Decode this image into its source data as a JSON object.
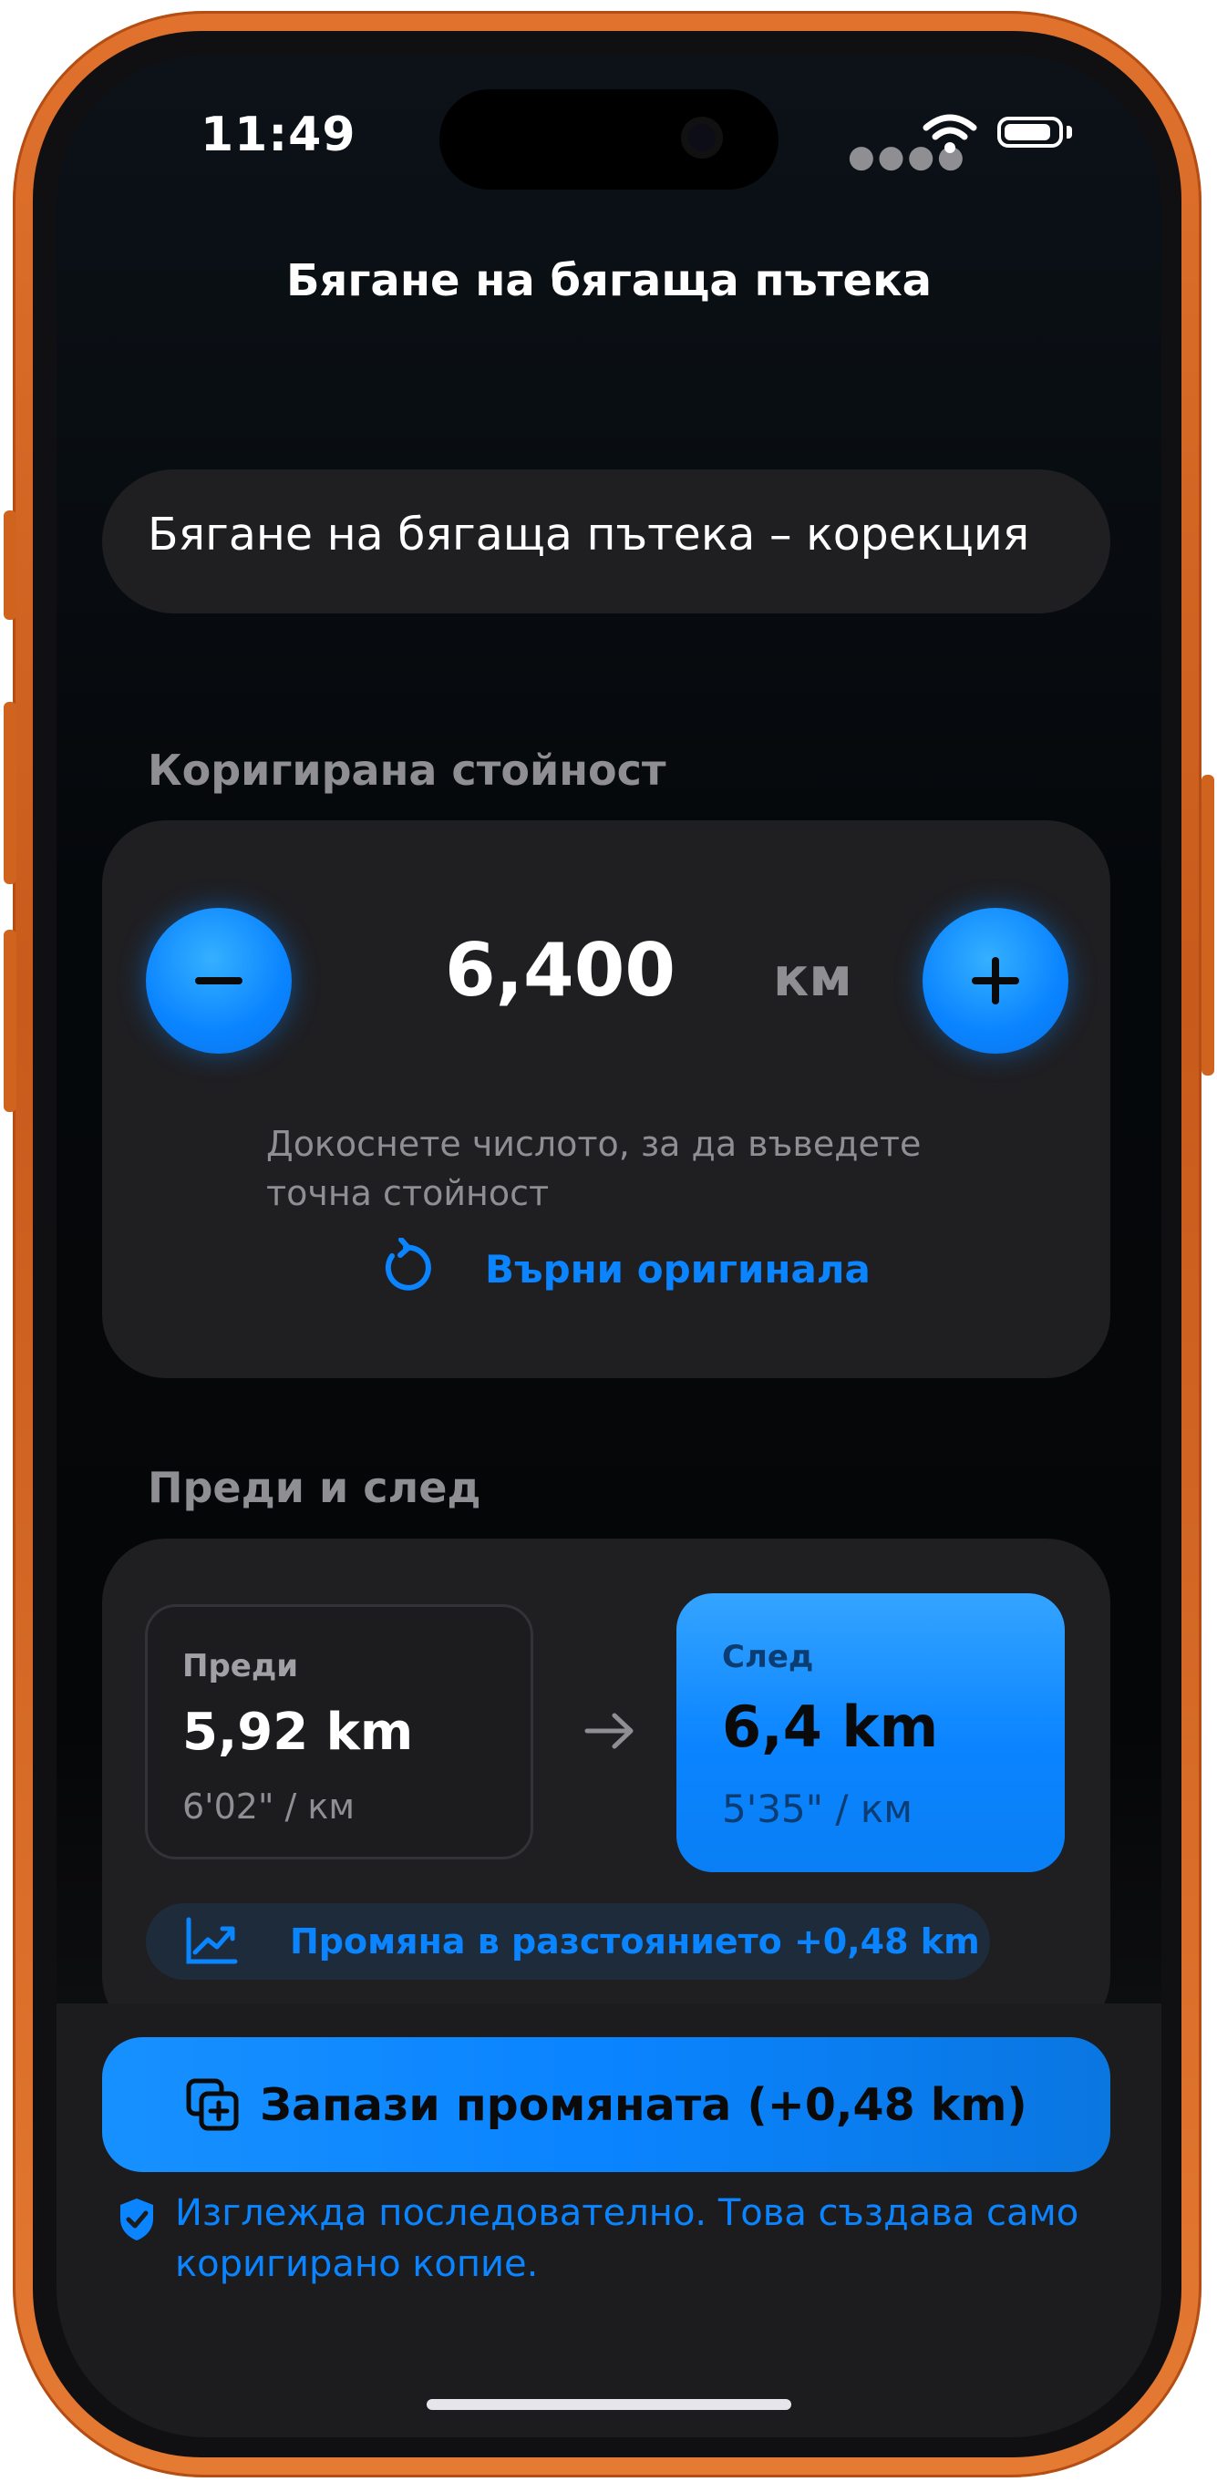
{
  "status_bar": {
    "time": "11:49"
  },
  "nav": {
    "title": "Бягане на бягаща пътека"
  },
  "activity_name": "Бягане на бягаща пътека – корекция",
  "corrected": {
    "section_label": "Коригирана стойност",
    "value": "6,400",
    "unit": "км",
    "hint": "Докоснете числото, за да въведете точна стойност",
    "revert_label": "Върни оригинала"
  },
  "comparison": {
    "section_label": "Преди и след",
    "before": {
      "label": "Преди",
      "distance": "5,92 km",
      "pace": "6'02\" / км"
    },
    "after": {
      "label": "След",
      "distance": "6,4 km",
      "pace": "5'35\" / км"
    },
    "change_text": "Промяна в разстоянието +0,48 km"
  },
  "save_button": {
    "label": "Запази промяната (+0,48 km)"
  },
  "note": "Изглежда последователно. Това създава само коригирано копие.",
  "colors": {
    "accent": "#0a84ff",
    "frame": "#e0722e",
    "card": "#1f1f22"
  },
  "icons": [
    "minus-icon",
    "plus-icon",
    "revert-icon",
    "arrow-right-icon",
    "chart-trend-icon",
    "duplicate-icon",
    "shield-check-icon",
    "wifi-icon",
    "battery-icon"
  ]
}
